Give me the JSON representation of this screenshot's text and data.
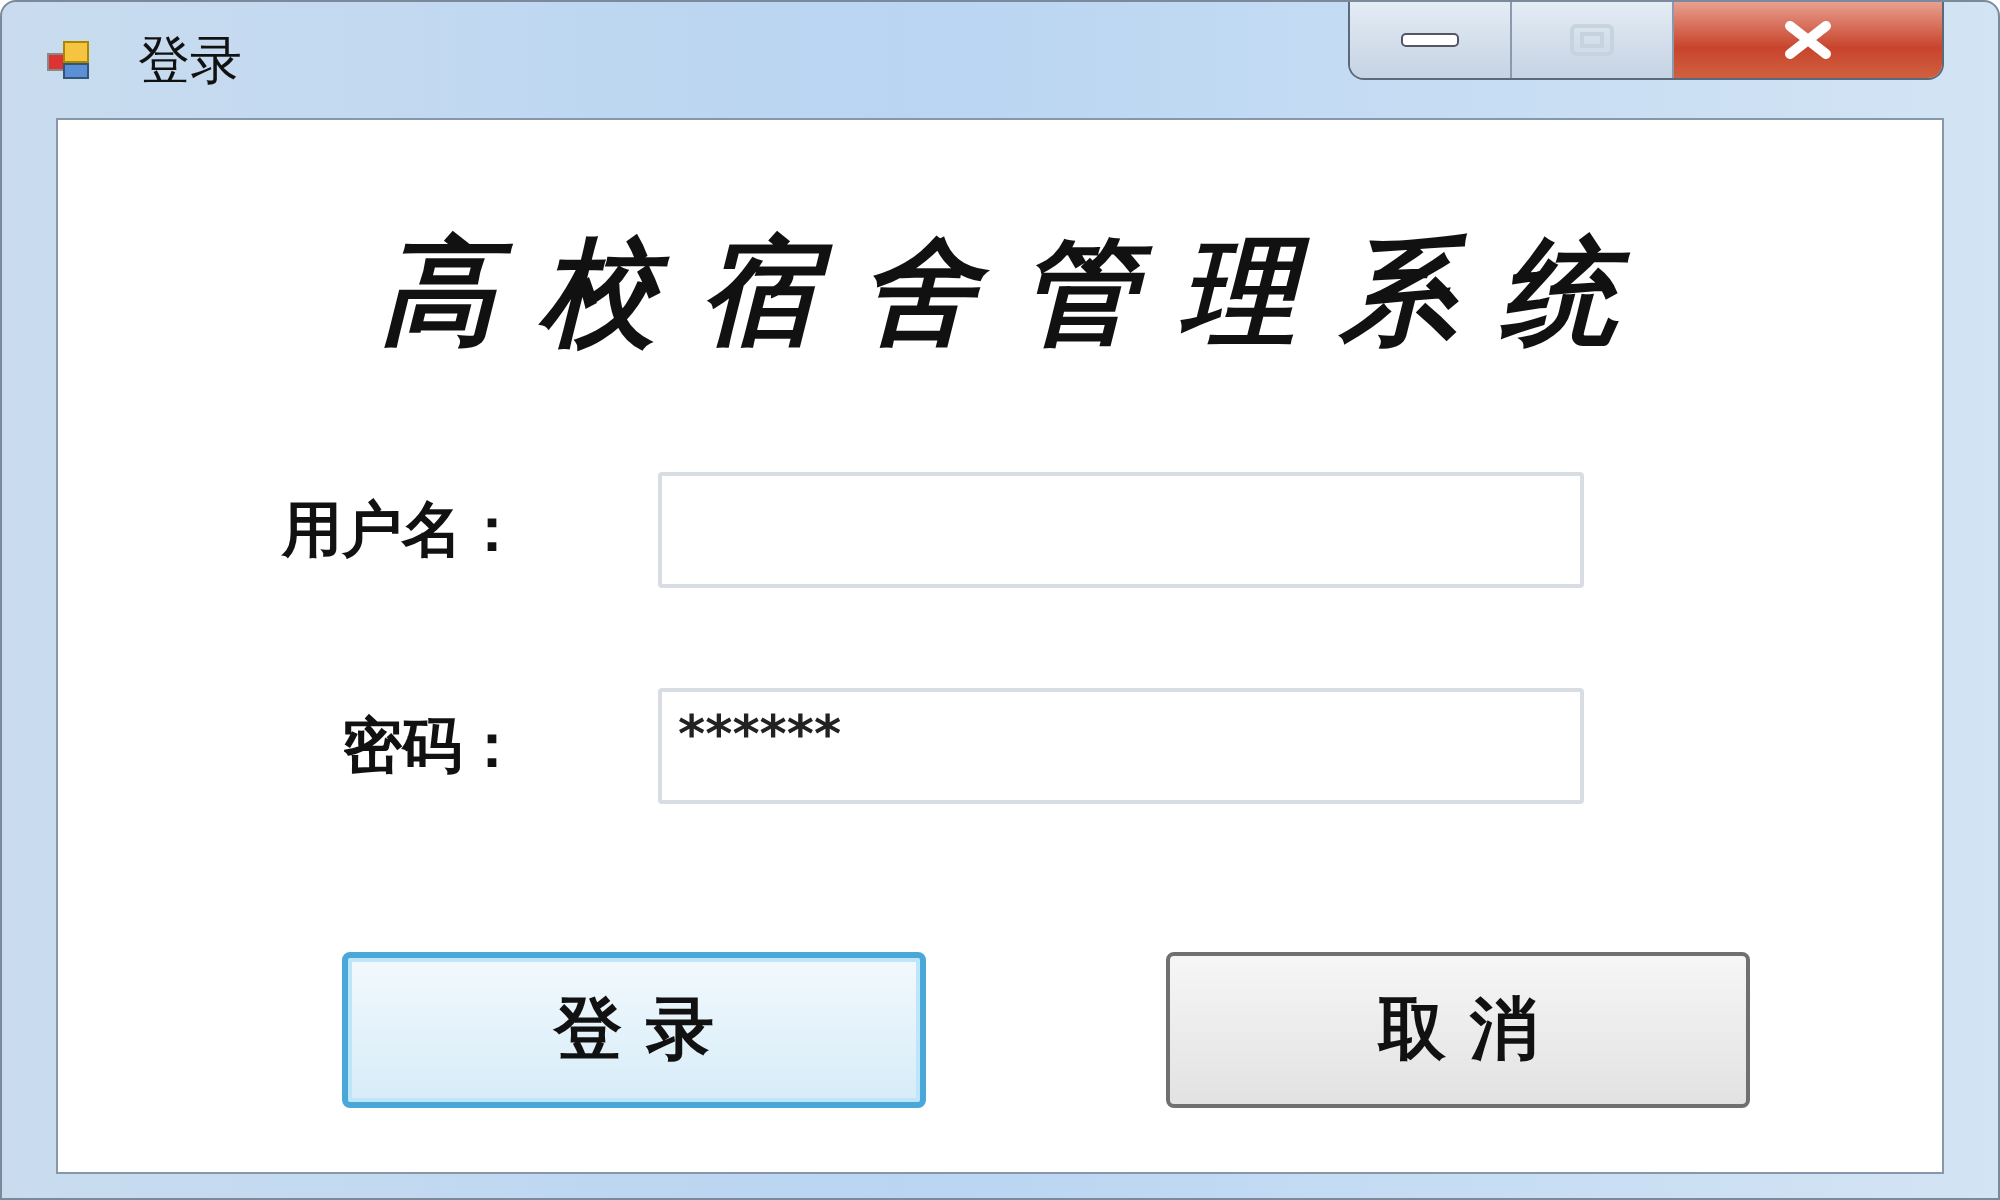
{
  "window": {
    "title": "登录"
  },
  "heading": "高校宿舍管理系统",
  "fields": [
    {
      "label": "用户名："
    },
    {
      "label": "密码：",
      "value": "******"
    }
  ],
  "buttons": [
    {
      "label": "登 录",
      "focused": true
    },
    {
      "label": "取 消",
      "focused": false
    }
  ]
}
